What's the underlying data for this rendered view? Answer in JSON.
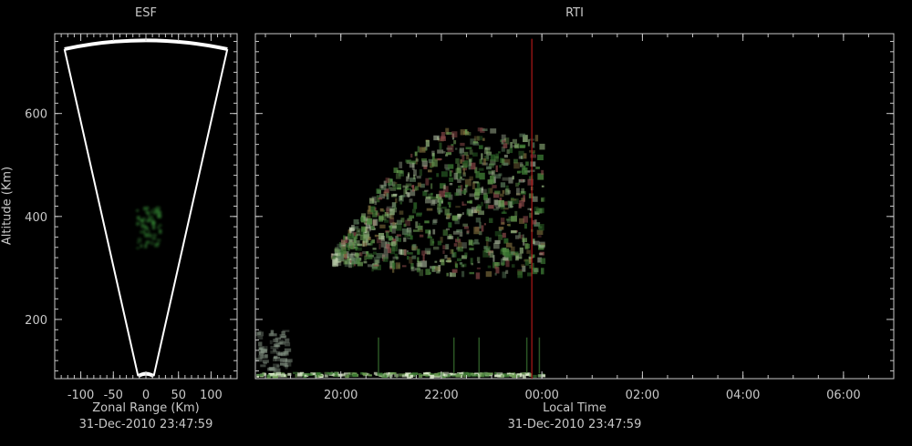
{
  "chart_data": [
    {
      "type": "heatmap",
      "title": "ESF",
      "xlabel": "Zonal Range (Km)",
      "ylabel": "Altitude (Km)",
      "timestamp": "31-Dec-2010 23:47:59",
      "x_ticks": [
        -100,
        -50,
        0,
        50,
        100
      ],
      "y_ticks": [
        200,
        400,
        600
      ],
      "xlim": [
        -140,
        140
      ],
      "ylim": [
        85,
        755
      ],
      "fan_beam": {
        "apex_altitude": 90,
        "outer_altitude": 745,
        "half_width_at_outer": 125
      },
      "echo_region": {
        "x_range": [
          -15,
          20
        ],
        "altitude_range": [
          340,
          420
        ]
      },
      "colors": {
        "background": "#000000",
        "outline": "#ffffff",
        "echo": "#2f7a2f"
      }
    },
    {
      "type": "heatmap",
      "title": "RTI",
      "xlabel": "Local Time",
      "timestamp": "31-Dec-2010 23:47:59",
      "x_ticks": [
        "20:00",
        "22:00",
        "00:00",
        "02:00",
        "04:00",
        "06:00"
      ],
      "x_tick_hours": [
        20,
        22,
        24,
        26,
        28,
        30
      ],
      "xlim_hours": [
        18.3,
        31.0
      ],
      "ylim": [
        85,
        755
      ],
      "current_time": "23:47:59",
      "current_time_hours": 23.8,
      "echo_plume": {
        "time_range_hours": [
          19.8,
          24.0
        ],
        "altitude_range": [
          290,
          580
        ]
      },
      "low_echo_band": {
        "time_range_hours": [
          18.3,
          24.0
        ],
        "altitude": 95
      },
      "colors": {
        "background": "#000000",
        "time_marker": "#b01818",
        "echo": "#3d7a34",
        "echo_highlight": "#d8e8c8"
      }
    }
  ]
}
